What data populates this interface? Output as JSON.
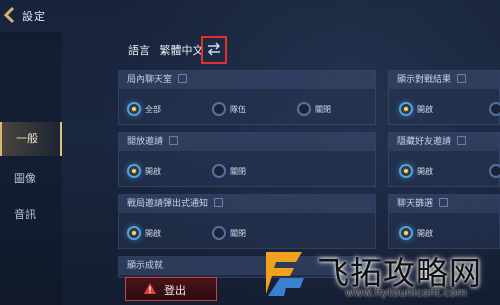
{
  "app": {
    "title": "設定"
  },
  "sidebar": {
    "items": [
      {
        "label": "一般",
        "active": true
      },
      {
        "label": "圖像",
        "active": false
      },
      {
        "label": "音訊",
        "active": false
      }
    ]
  },
  "language": {
    "label": "語言",
    "value": "繁體中文"
  },
  "panels": {
    "lobby_chat": {
      "title": "局內聊天室",
      "options": [
        "全部",
        "隊伍",
        "關閉"
      ],
      "selected": "全部"
    },
    "show_results": {
      "title": "顯示對戰結果",
      "options": [
        "開啟"
      ],
      "selected": "開啟"
    },
    "open_invite": {
      "title": "開放邀請",
      "options": [
        "開啟",
        "關閉"
      ],
      "selected": "開啟"
    },
    "hide_invite": {
      "title": "隱藏好友邀請",
      "options": [
        "開啟"
      ],
      "selected": "開啟"
    },
    "popup_notice": {
      "title": "戰局邀請彈出式通知",
      "options": [
        "開啟",
        "關閉"
      ],
      "selected": "開啟"
    },
    "chat_filter": {
      "title": "聊天篩選",
      "options": [
        "開啟"
      ],
      "selected": "開啟"
    },
    "show_achieve": {
      "title": "顯示成就"
    }
  },
  "logout": {
    "label": "登出"
  },
  "watermark": {
    "text": "飞拓攻略网",
    "url": "www.fiytounicont.com"
  },
  "colors": {
    "accent": "#4fa0e4",
    "highlight_box": "#e0322a",
    "logout_border": "#b8454c"
  }
}
